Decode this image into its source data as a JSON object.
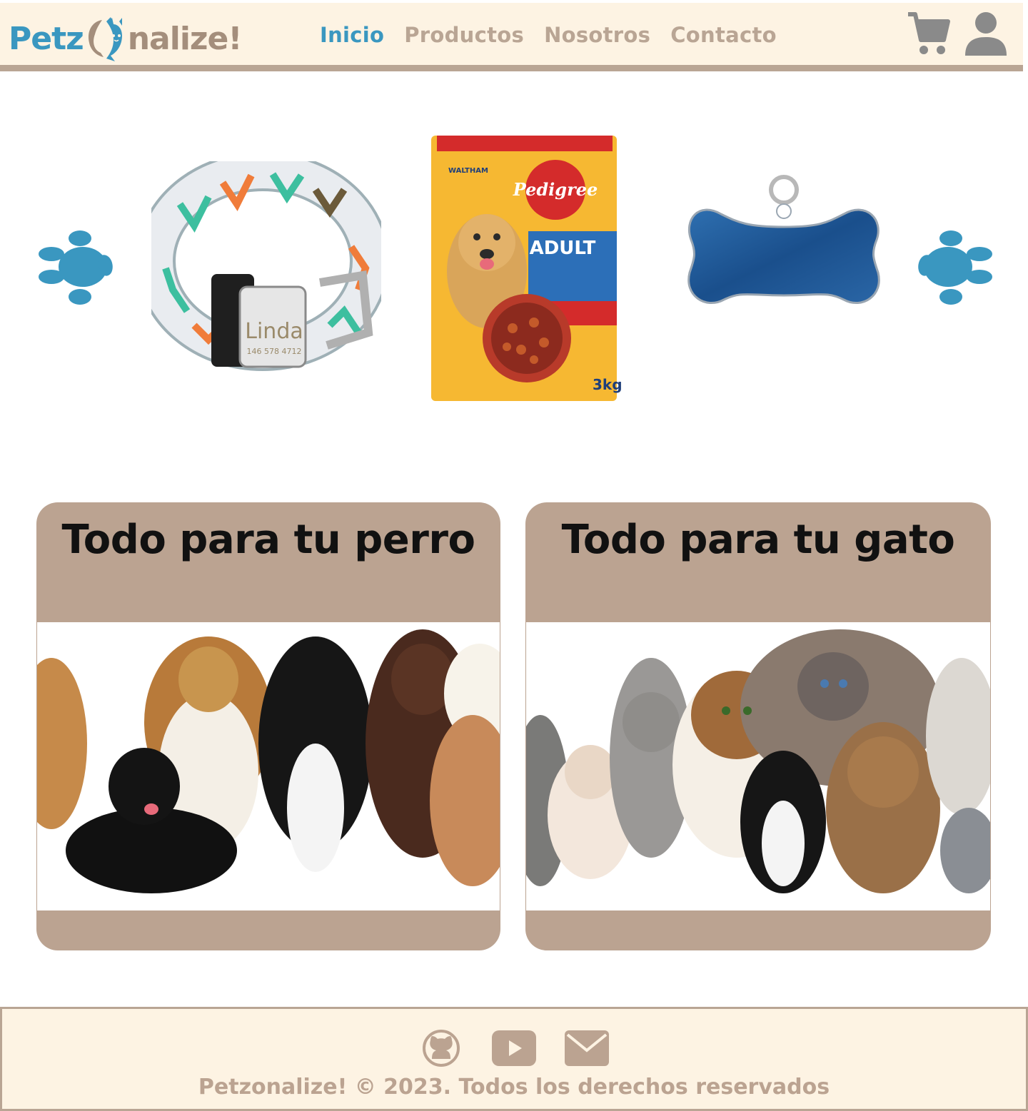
{
  "header": {
    "logo": {
      "part1": "Petz",
      "part2": "nalize!"
    },
    "nav": [
      {
        "label": "Inicio",
        "active": true
      },
      {
        "label": "Productos",
        "active": false
      },
      {
        "label": "Nosotros",
        "active": false
      },
      {
        "label": "Contacto",
        "active": false
      }
    ],
    "icons": [
      "cart-icon",
      "user-icon"
    ]
  },
  "carousel": {
    "products": [
      {
        "name": "collar",
        "text": "Linda",
        "number": "146 578 4712"
      },
      {
        "name": "dog-food-bag",
        "brand": "Pedigree",
        "label": "ADULT",
        "maker": "WALTHAM",
        "weight": "3kg"
      },
      {
        "name": "bone-id-tag"
      }
    ],
    "arrows": [
      "paw-left-icon",
      "paw-right-icon"
    ]
  },
  "cards": {
    "dog": {
      "title": "Todo para tu perro"
    },
    "cat": {
      "title": "Todo para tu gato"
    }
  },
  "footer": {
    "icons": [
      "github-icon",
      "youtube-icon",
      "mail-icon"
    ],
    "copyright": "Petzonalize! © 2023. Todos los derechos reservados"
  },
  "colors": {
    "primary_blue": "#3a97c0",
    "beige": "#fdf3e3",
    "taupe": "#bba391"
  }
}
